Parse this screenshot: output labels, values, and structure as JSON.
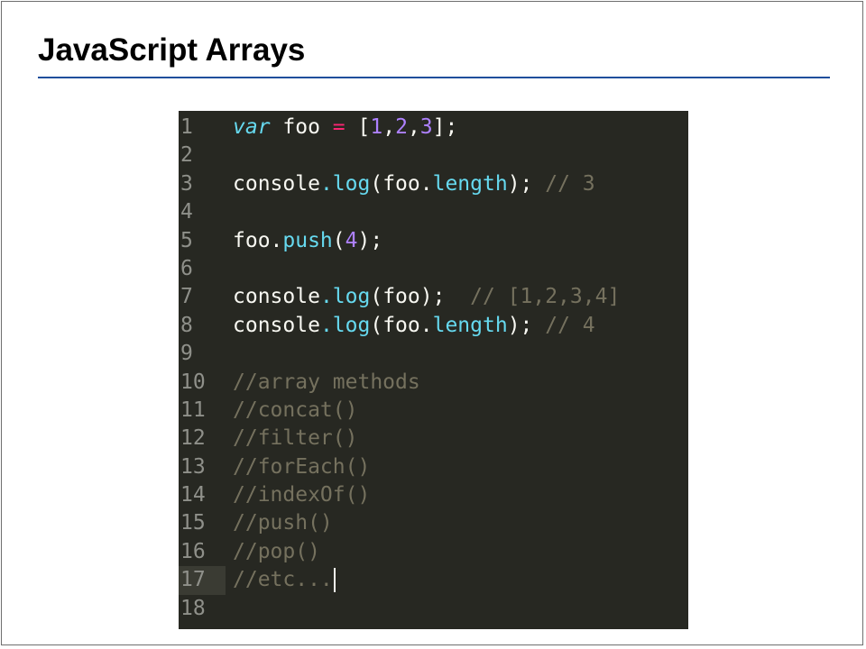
{
  "slide": {
    "title": "JavaScript Arrays"
  },
  "colors": {
    "title_rule": "#1f4e9c",
    "editor_background": "#272822",
    "keyword": "#66d9ef",
    "operator": "#f92672",
    "number": "#ae81ff",
    "comment": "#75715e",
    "text": "#f8f8f2",
    "line_number": "#8f908a"
  },
  "editor": {
    "current_line": "17",
    "lines": [
      {
        "number": "1",
        "tokens": [
          "var",
          " foo ",
          "=",
          " [",
          "1",
          ",",
          "2",
          ",",
          "3",
          "];"
        ]
      },
      {
        "number": "2"
      },
      {
        "number": "3",
        "tokens": [
          "console",
          ".",
          "log",
          "(foo.",
          "length",
          ");",
          " // 3"
        ]
      },
      {
        "number": "4"
      },
      {
        "number": "5",
        "tokens": [
          "foo.",
          "push",
          "(",
          "4",
          ");"
        ]
      },
      {
        "number": "6"
      },
      {
        "number": "7",
        "tokens": [
          "console",
          ".",
          "log",
          "(foo);",
          "  // [1,2,3,4]"
        ]
      },
      {
        "number": "8",
        "tokens": [
          "console",
          ".",
          "log",
          "(foo.",
          "length",
          ");",
          " // 4"
        ]
      },
      {
        "number": "9"
      },
      {
        "number": "10",
        "tokens": [
          "//array methods"
        ]
      },
      {
        "number": "11",
        "tokens": [
          "//concat()"
        ]
      },
      {
        "number": "12",
        "tokens": [
          "//filter()"
        ]
      },
      {
        "number": "13",
        "tokens": [
          "//forEach()"
        ]
      },
      {
        "number": "14",
        "tokens": [
          "//indexOf()"
        ]
      },
      {
        "number": "15",
        "tokens": [
          "//push()"
        ]
      },
      {
        "number": "16",
        "tokens": [
          "//pop()"
        ]
      },
      {
        "number": "17",
        "tokens": [
          "//etc..."
        ]
      },
      {
        "number": "18"
      }
    ]
  }
}
